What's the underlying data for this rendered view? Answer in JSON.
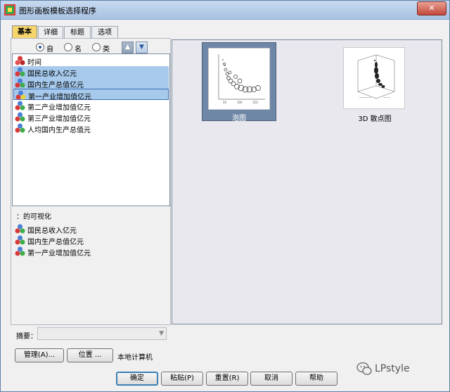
{
  "window": {
    "title": "图形画板模板选择程序",
    "close_label": "✕"
  },
  "tabs": [
    {
      "label": "基本",
      "active": true
    },
    {
      "label": "详细",
      "active": false
    },
    {
      "label": "标题",
      "active": false
    },
    {
      "label": "选项",
      "active": false
    }
  ],
  "sort": {
    "options": [
      "自然",
      "名称",
      "类型"
    ],
    "selected": "自然",
    "asc_label": "▲",
    "desc_label": "▼"
  },
  "variables": [
    {
      "label": "时间",
      "selected": false
    },
    {
      "label": "国民总收入亿元",
      "selected": true
    },
    {
      "label": "国内生产总值亿元",
      "selected": true
    },
    {
      "label": "第一产业增加值亿元",
      "selected": true,
      "focused": true
    },
    {
      "label": "第二产业增加值亿元",
      "selected": false
    },
    {
      "label": "第三产业增加值亿元",
      "selected": false
    },
    {
      "label": "人均国内生产总值元",
      "selected": false
    }
  ],
  "visualization": {
    "label": "：的可视化",
    "items": [
      "国民总收入亿元",
      "国内生产总值亿元",
      "第一产业增加值亿元"
    ]
  },
  "summary": {
    "label": "摘要：",
    "value": ""
  },
  "buttons": {
    "manage": "管理(A)...",
    "location": "位置 ...",
    "local_computer": "本地计算机",
    "ok": "确定",
    "paste": "粘贴(P)",
    "reset": "重置(R)",
    "cancel": "取消",
    "help": "帮助"
  },
  "gallery": [
    {
      "label": "泡图",
      "selected": true
    },
    {
      "label": "3D 散点图",
      "selected": false
    }
  ],
  "watermark": "LPstyle",
  "colors": {
    "selection": "#a6c9ec",
    "active_tab": "#f6d56c",
    "selected_thumb": "#6f87a6"
  }
}
